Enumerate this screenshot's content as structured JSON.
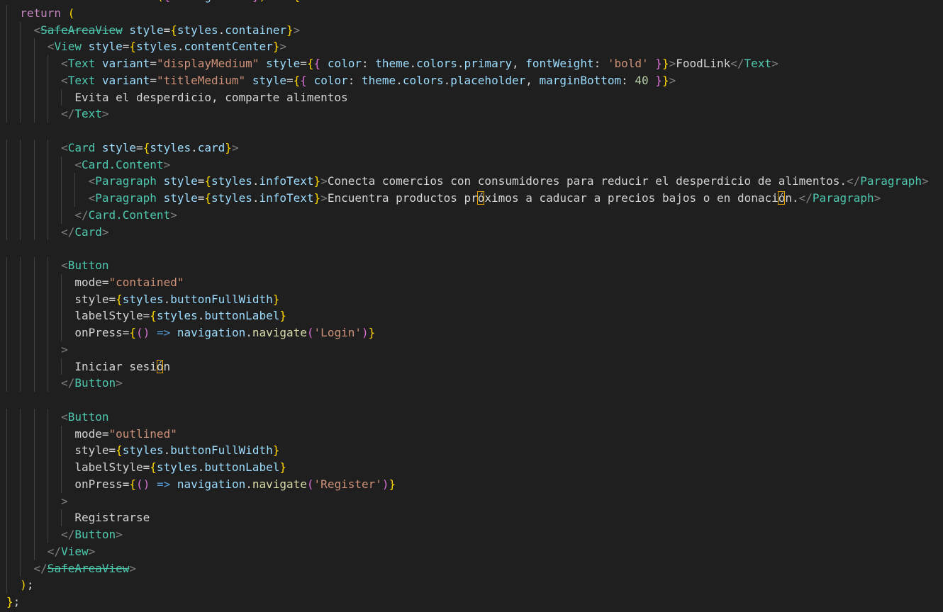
{
  "editor": {
    "language": "javascript-react",
    "theme": "dark",
    "lines": [
      "const WelcomeScreen = ({ navigation }) => {",
      "  return (",
      "    <SafeAreaView style={styles.container}>",
      "      <View style={styles.contentCenter}>",
      "        <Text variant=\"displayMedium\" style={{ color: theme.colors.primary, fontWeight: 'bold' }}>FoodLink</Text>",
      "        <Text variant=\"titleMedium\" style={{ color: theme.colors.placeholder, marginBottom: 40 }}>",
      "          Evita el desperdicio, comparte alimentos",
      "        </Text>",
      "",
      "        <Card style={styles.card}>",
      "          <Card.Content>",
      "            <Paragraph style={styles.infoText}>Conecta comercios con consumidores para reducir el desperdicio de alimentos.</Paragraph>",
      "            <Paragraph style={styles.infoText}>Encuentra productos próximos a caducar a precios bajos o en donación.</Paragraph>",
      "          </Card.Content>",
      "        </Card>",
      "",
      "        <Button",
      "          mode=\"contained\"",
      "          style={styles.buttonFullWidth}",
      "          labelStyle={styles.buttonLabel}",
      "          onPress={() => navigation.navigate('Login')}",
      "        >",
      "          Iniciar sesión",
      "        </Button>",
      "",
      "        <Button",
      "          mode=\"outlined\"",
      "          style={styles.buttonFullWidth}",
      "          labelStyle={styles.buttonLabel}",
      "          onPress={() => navigation.navigate('Register')}",
      "        >",
      "          Registrarse",
      "        </Button>",
      "      </View>",
      "    </SafeAreaView>",
      "  );",
      "};"
    ]
  }
}
